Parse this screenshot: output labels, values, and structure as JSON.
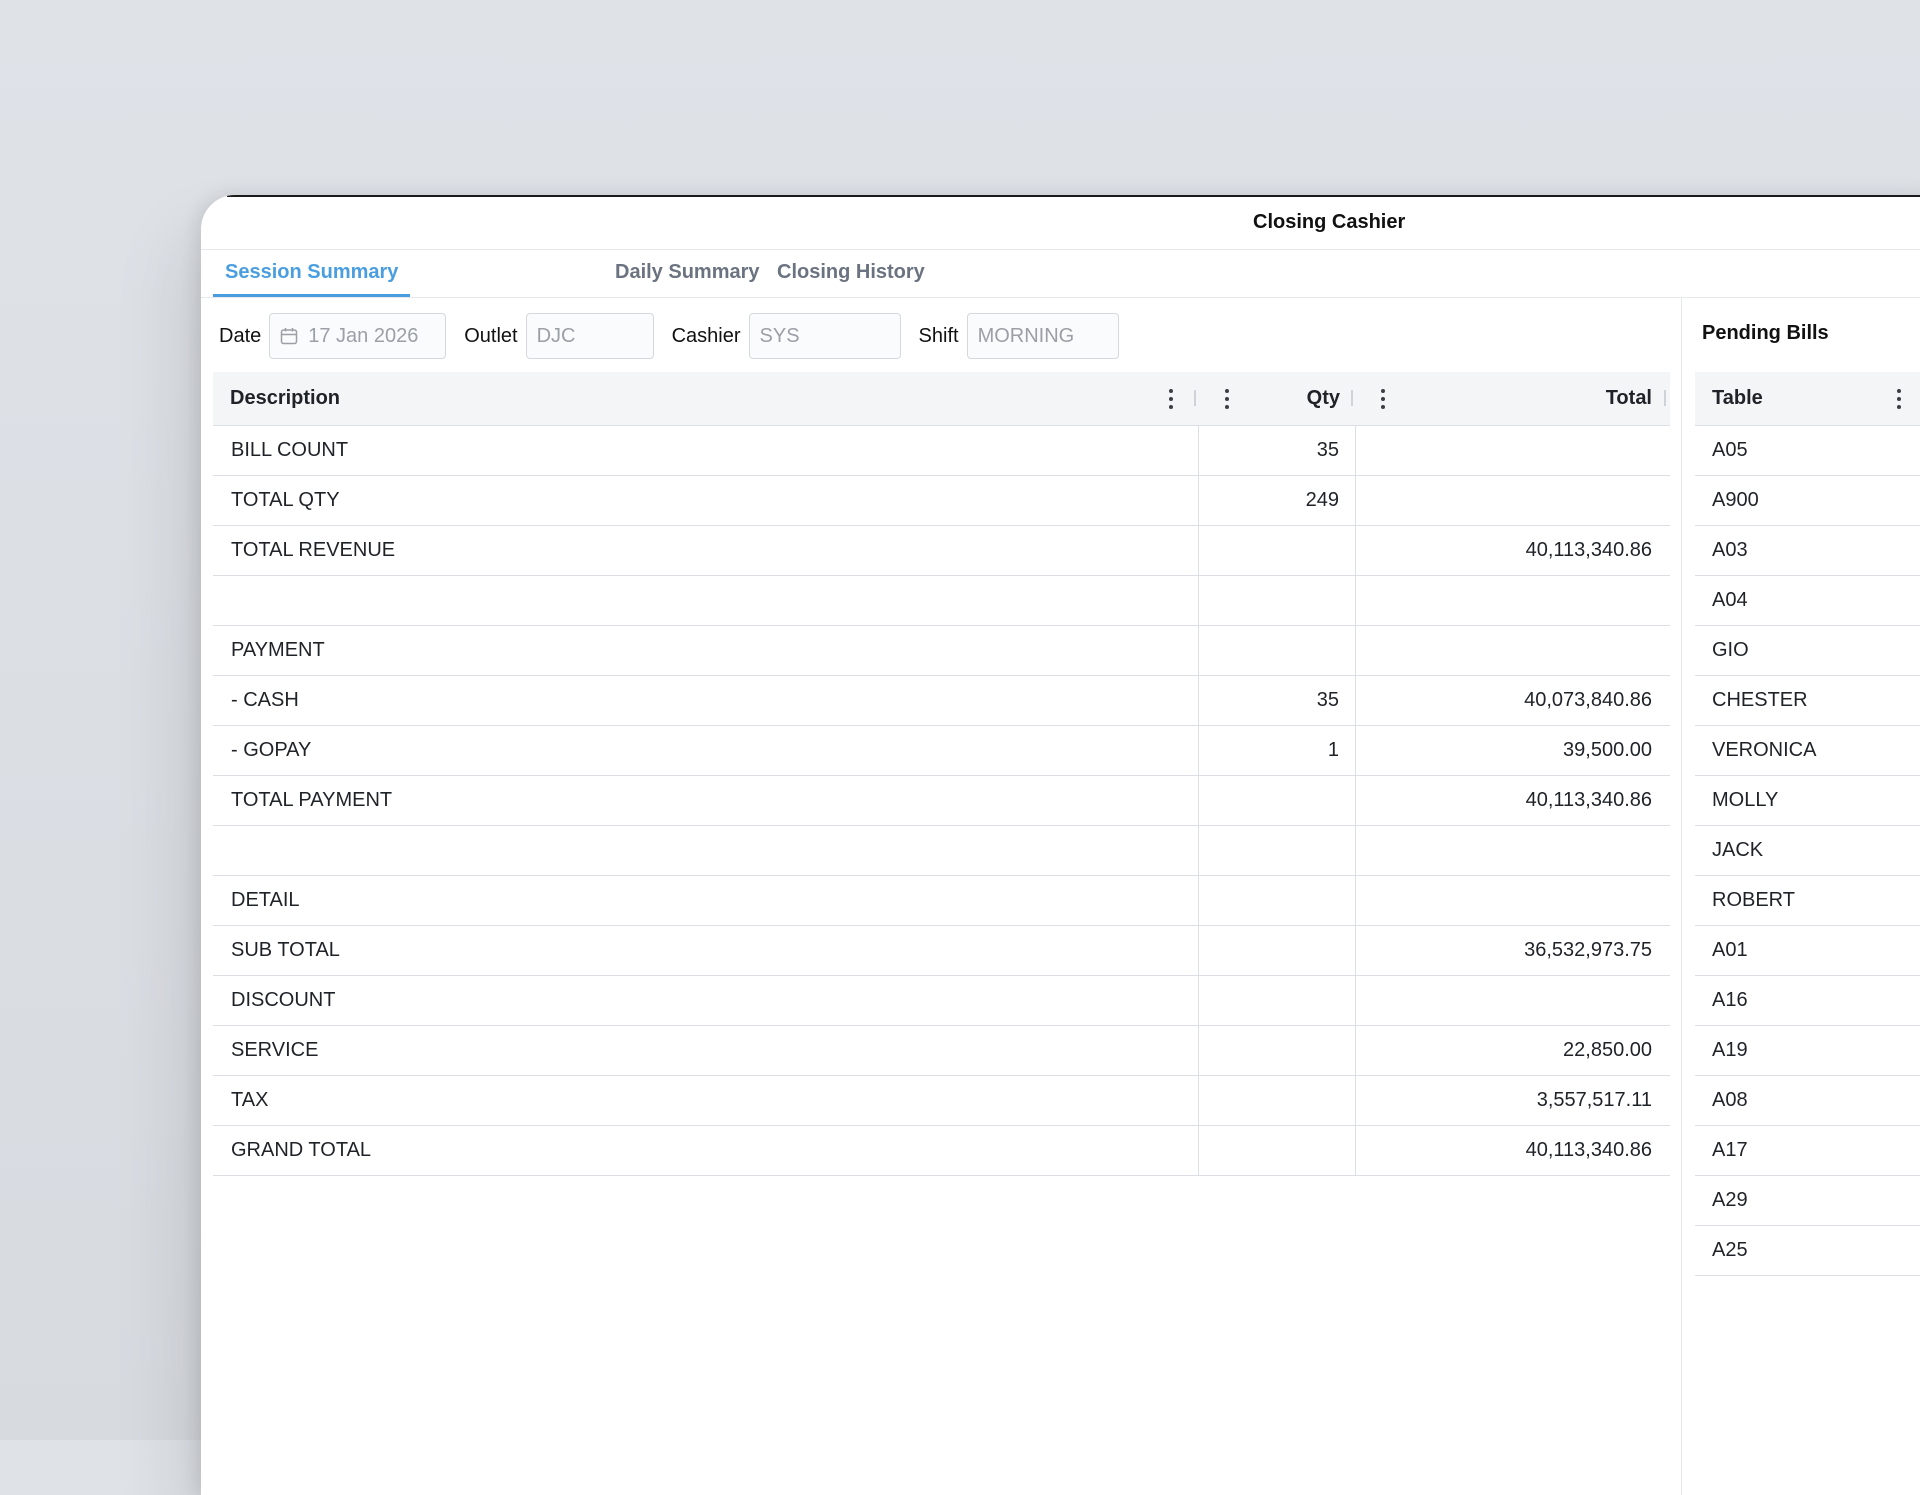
{
  "window": {
    "title": "Closing Cashier"
  },
  "tabs": [
    {
      "label": "Session Summary",
      "active": true
    },
    {
      "label": "Daily Summary",
      "active": false
    },
    {
      "label": "Closing History",
      "active": false
    }
  ],
  "filters": {
    "date_label": "Date",
    "date_value": "17 Jan 2026",
    "outlet_label": "Outlet",
    "outlet_value": "DJC",
    "cashier_label": "Cashier",
    "cashier_value": "SYS",
    "shift_label": "Shift",
    "shift_value": "MORNING"
  },
  "summary_table": {
    "columns": [
      "Description",
      "Qty",
      "Total"
    ],
    "rows": [
      [
        "BILL COUNT",
        "35",
        ""
      ],
      [
        "TOTAL QTY",
        "249",
        ""
      ],
      [
        "TOTAL REVENUE",
        "",
        "40,113,340.86"
      ],
      [
        "",
        "",
        ""
      ],
      [
        "PAYMENT",
        "",
        ""
      ],
      [
        "- CASH",
        "35",
        "40,073,840.86"
      ],
      [
        "- GOPAY",
        "1",
        "39,500.00"
      ],
      [
        "TOTAL PAYMENT",
        "",
        "40,113,340.86"
      ],
      [
        "",
        "",
        ""
      ],
      [
        "DETAIL",
        "",
        ""
      ],
      [
        "SUB TOTAL",
        "",
        "36,532,973.75"
      ],
      [
        "DISCOUNT",
        "",
        ""
      ],
      [
        "SERVICE",
        "",
        "22,850.00"
      ],
      [
        "TAX",
        "",
        "3,557,517.11"
      ],
      [
        "GRAND TOTAL",
        "",
        "40,113,340.86"
      ]
    ]
  },
  "pending_bills": {
    "title": "Pending Bills",
    "column": "Table",
    "rows": [
      "A05",
      "A900",
      "A03",
      "A04",
      "GIO",
      "CHESTER",
      "VERONICA",
      "MOLLY",
      "JACK",
      "ROBERT",
      "A01",
      "A16",
      "A19",
      "A08",
      "A17",
      "A29",
      "A25"
    ]
  },
  "colors": {
    "accent": "#4a9ee0"
  },
  "icons": {
    "date": "calendar-icon",
    "column_menu": "kebab-menu-icon"
  }
}
